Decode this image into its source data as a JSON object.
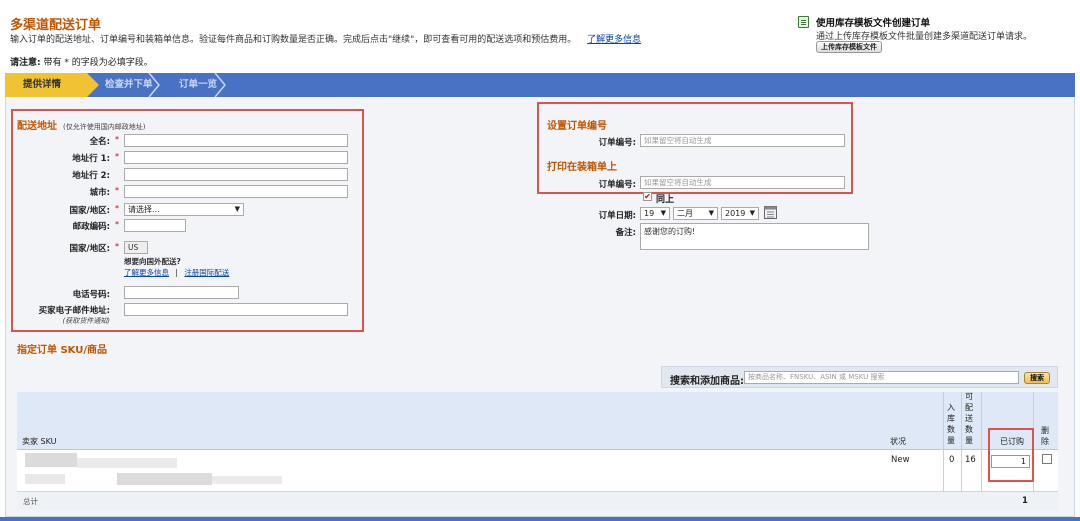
{
  "header": {
    "title": "多渠道配送订单",
    "description": "输入订单的配送地址、订单编号和装箱单信息。验证每件商品和订购数量是否正确。完成后点击\"继续\"，即可查看可用的配送选项和预估费用。",
    "learn_more": "了解更多信息",
    "required_note_bold": "请注意:",
    "required_note": "带有 * 的字段为必填字段。"
  },
  "template_panel": {
    "icon": "spreadsheet-icon",
    "title": "使用库存模板文件创建订单",
    "description": "通过上传库存模板文件批量创建多渠道配送订单请求。",
    "button": "上传库存模板文件"
  },
  "steps": [
    {
      "label": "提供详情",
      "active": true
    },
    {
      "label": "检查并下单",
      "active": false
    },
    {
      "label": "订单一览",
      "active": false
    }
  ],
  "address": {
    "title": "配送地址",
    "subtitle": "(仅允许使用国内邮政地址)",
    "fields": {
      "full_name": "全名:",
      "line1": "地址行 1:",
      "line2": "地址行 2:",
      "city": "城市:",
      "country_region": "国家/地区:",
      "postal_code": "邮政编码:",
      "country_region2": "国家/地区:",
      "phone": "电话号码:",
      "buyer_email": "买家电子邮件地址:",
      "buyer_email_note": "(获取货件通知)"
    },
    "required_mark": "*",
    "country_select_value": "请选择...",
    "country_code": "US",
    "intl_question": "想要向国外配送?",
    "intl_learn_more": "了解更多信息",
    "intl_separator": "|",
    "intl_register": "注册国际配送"
  },
  "order_number": {
    "title": "设置订单编号",
    "label": "订单编号:",
    "placeholder": "如果留空将自动生成"
  },
  "packing_slip": {
    "title": "打印在装箱单上",
    "label": "订单编号:",
    "placeholder": "如果留空将自动生成",
    "same_as_above": "同上",
    "same_checked": true,
    "date_label": "订单日期:",
    "day": "19",
    "month": "二月",
    "year": "2019",
    "calendar_icon": "calendar-icon",
    "note_label": "备注:",
    "note_value": "感谢您的订购!"
  },
  "products": {
    "title": "指定订单 SKU/商品",
    "search_label": "搜索和添加商品:",
    "search_placeholder": "按商品名称、FNSKU、ASIN 或 MSKU 搜索",
    "search_button": "搜索",
    "columns": {
      "sku": "卖家 SKU",
      "condition": "状况",
      "inbound": "入库数量",
      "available": "可配送数量",
      "ordered": "已订购",
      "delete": "删除"
    },
    "rows": [
      {
        "condition": "New",
        "inbound": "0",
        "available": "16",
        "ordered": "1"
      }
    ],
    "footer_label": "总计",
    "footer_total": "1"
  }
}
